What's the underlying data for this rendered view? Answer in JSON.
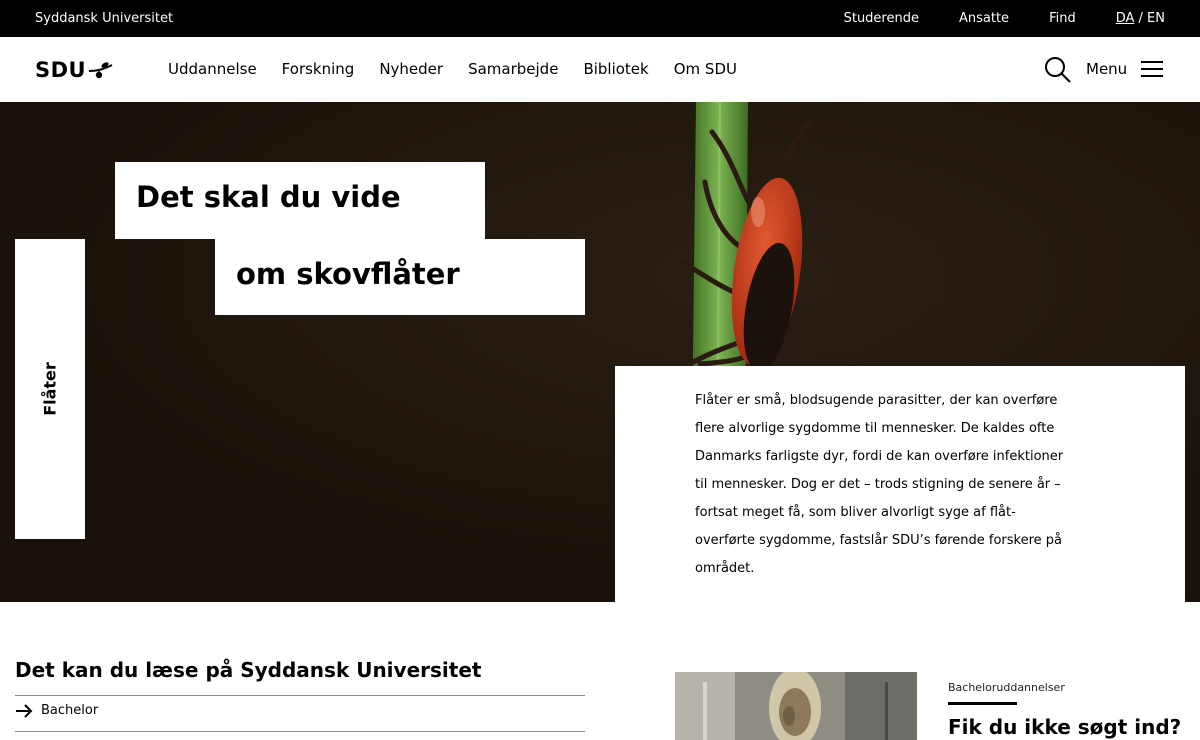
{
  "utility_bar": {
    "brand": "Syddansk Universitet",
    "links": [
      "Studerende",
      "Ansatte",
      "Find"
    ],
    "lang_da": "DA",
    "lang_sep": " / ",
    "lang_en": "EN"
  },
  "header": {
    "logo_text": "SDU",
    "nav": [
      "Uddannelse",
      "Forskning",
      "Nyheder",
      "Samarbejde",
      "Bibliotek",
      "Om SDU"
    ],
    "menu_label": "Menu"
  },
  "hero": {
    "title_line1": "Det skal du vide",
    "title_line2": "om skovflåter",
    "side_tab": "Flåter",
    "description": "Flåter er små, blodsugende parasitter, der kan overføre flere alvorlige sygdomme til mennesker. De kaldes ofte Danmarks farligste dyr, fordi de kan overføre infektioner til mennesker. Dog er det – trods stigning de senere år – fortsat meget få, som bliver alvorligt syge af flåt-overførte sygdomme, fastslår SDU’s førende forskere på området."
  },
  "study": {
    "title": "Det kan du læse på Syddansk Universitet",
    "links": [
      "Bachelor"
    ]
  },
  "promo": {
    "kicker": "Bacheloruddannelser",
    "title": "Fik du ikke søgt ind?"
  },
  "colors": {
    "utility_bg": "#000000",
    "hero_bg": "#1e150d",
    "tick_red": "#c8361a",
    "stem_green": "#5f9a3a"
  },
  "icons": {
    "search": "search-icon",
    "menu": "hamburger-icon",
    "arrow": "arrow-right-icon",
    "logo_mark": "olive-branch-icon"
  }
}
